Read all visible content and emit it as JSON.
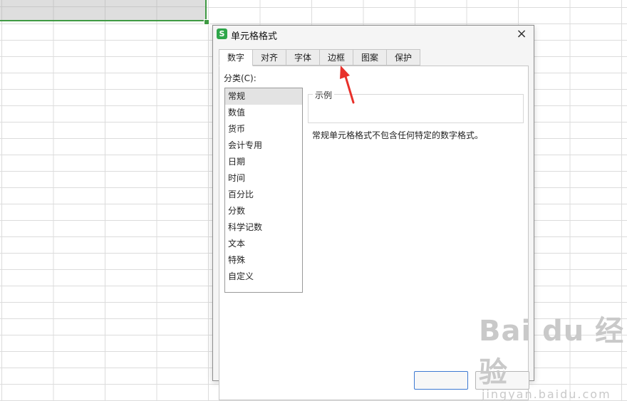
{
  "dialog": {
    "title": "单元格格式",
    "app_icon": "S",
    "close_icon": "×"
  },
  "tabs": [
    "数字",
    "对齐",
    "字体",
    "边框",
    "图案",
    "保护"
  ],
  "active_tab": "数字",
  "category": {
    "label": "分类(C):",
    "items": [
      "常规",
      "数值",
      "货币",
      "会计专用",
      "日期",
      "时间",
      "百分比",
      "分数",
      "科学记数",
      "文本",
      "特殊",
      "自定义"
    ],
    "selected": "常规"
  },
  "sample": {
    "legend": "示例"
  },
  "description": "常规单元格格式不包含任何特定的数字格式。",
  "annotation": {
    "color": "#e8302a"
  },
  "watermark": {
    "main": "Bai du 经验",
    "sub": "jingyan.baidu.com"
  },
  "colors": {
    "selection_border": "#3f9a43",
    "app_icon": "#2ea64a",
    "primary_button_border": "#3d79d2"
  }
}
